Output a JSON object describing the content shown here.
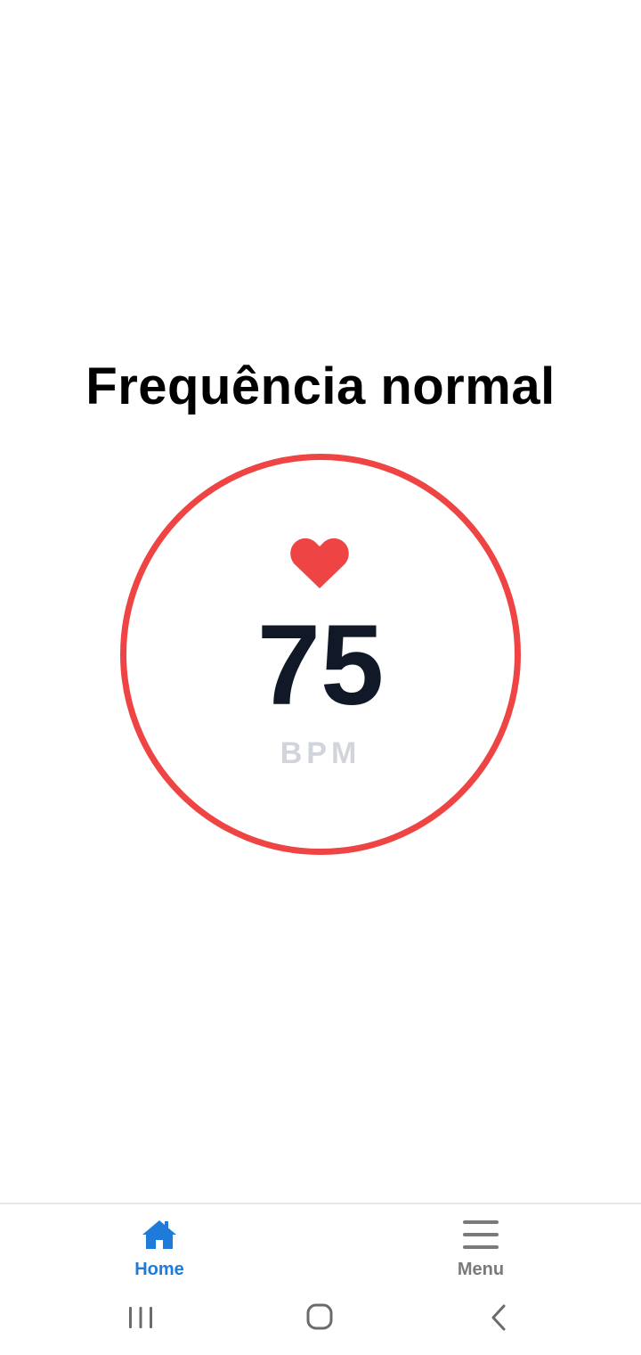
{
  "status": {
    "title": "Frequência normal"
  },
  "heart_rate": {
    "value": "75",
    "unit": "BPM",
    "icon": "heart-icon"
  },
  "bottom_nav": {
    "items": [
      {
        "label": "Home",
        "icon": "home-icon",
        "active": true
      },
      {
        "label": "Menu",
        "icon": "menu-icon",
        "active": false
      }
    ]
  },
  "system_nav": {
    "buttons": [
      "recent-apps-icon",
      "home-circle-icon",
      "back-icon"
    ]
  },
  "colors": {
    "accent_red": "#ef4444",
    "value_dark": "#111827",
    "unit_gray": "#d1d5db",
    "active_blue": "#1e7bd9",
    "inactive_gray": "#7a7a7a"
  }
}
